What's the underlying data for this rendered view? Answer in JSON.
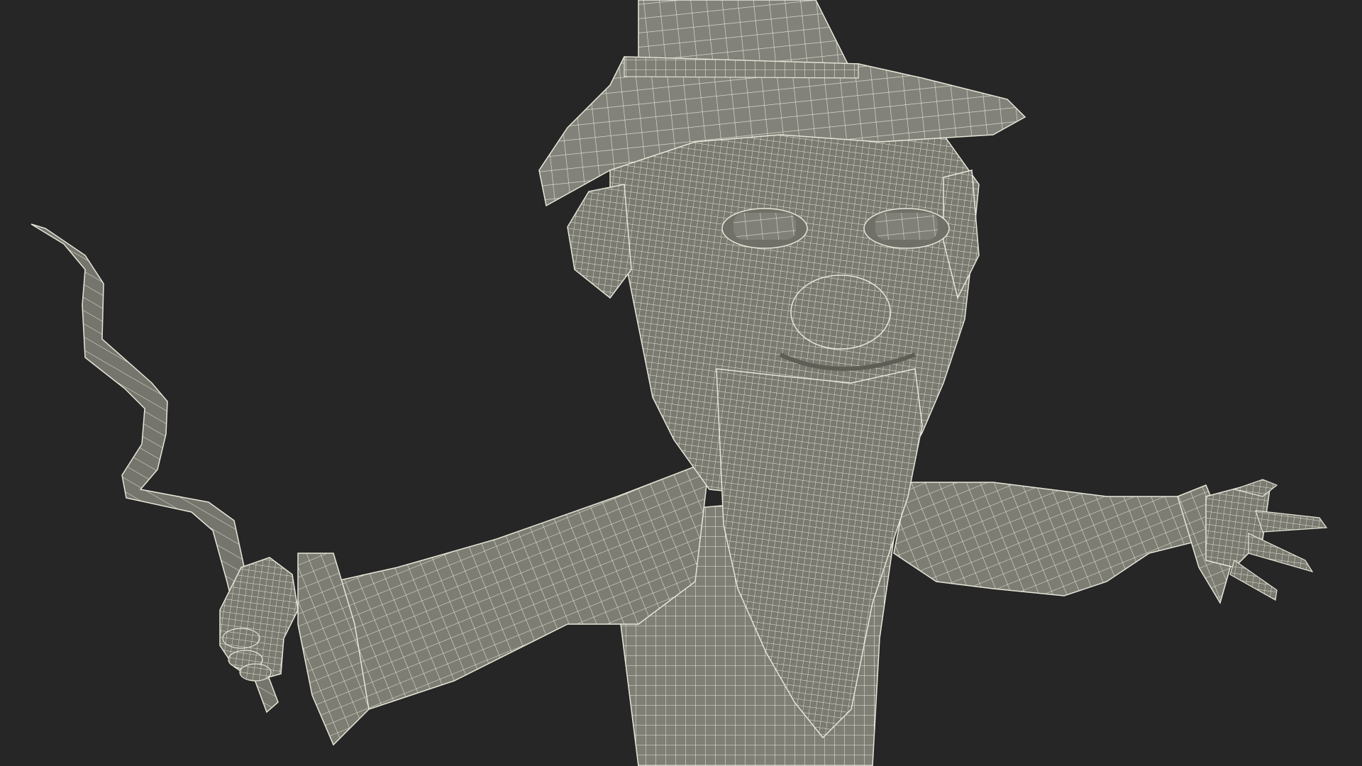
{
  "scene": {
    "subject": "wizard-wireframe-model",
    "colors": {
      "background": "#262626",
      "surface": "#7f7f76",
      "surface_shade": "#5e5e57",
      "wire": "#e6e6d9"
    }
  }
}
